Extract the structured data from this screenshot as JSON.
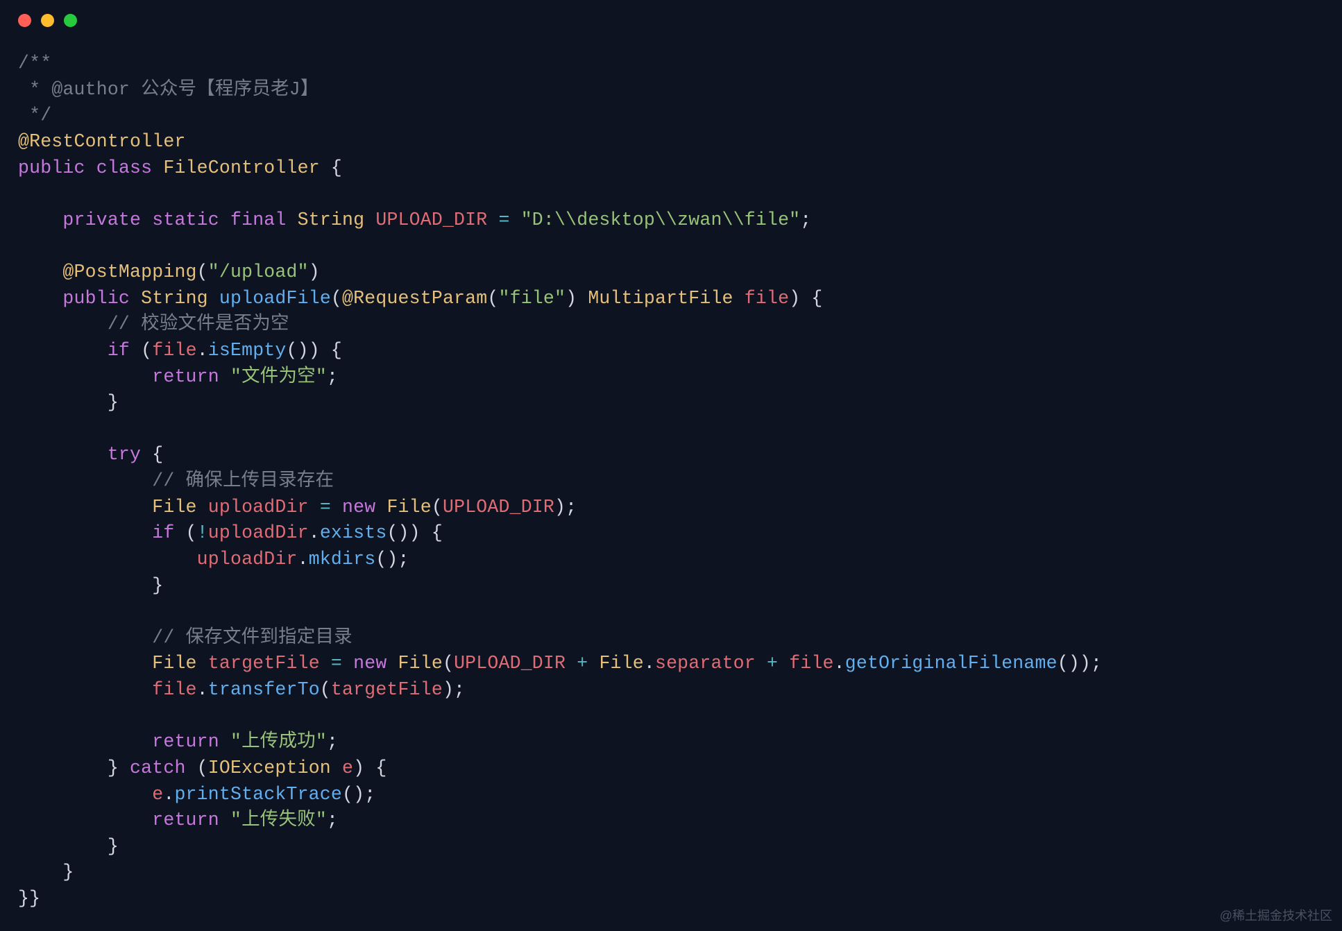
{
  "window": {
    "controls": [
      "close",
      "minimize",
      "maximize"
    ]
  },
  "code": {
    "lines": [
      {
        "tokens": [
          {
            "t": "/**",
            "c": "comment"
          }
        ]
      },
      {
        "tokens": [
          {
            "t": " * ",
            "c": "comment"
          },
          {
            "t": "@author",
            "c": "comment"
          },
          {
            "t": " 公众号【程序员老J】",
            "c": "comment"
          }
        ]
      },
      {
        "tokens": [
          {
            "t": " */",
            "c": "comment"
          }
        ]
      },
      {
        "tokens": [
          {
            "t": "@RestController",
            "c": "annotation"
          }
        ]
      },
      {
        "tokens": [
          {
            "t": "public",
            "c": "keyword"
          },
          {
            "t": " ",
            "c": "punc"
          },
          {
            "t": "class",
            "c": "keyword"
          },
          {
            "t": " ",
            "c": "punc"
          },
          {
            "t": "FileController",
            "c": "class"
          },
          {
            "t": " {",
            "c": "punc"
          }
        ]
      },
      {
        "tokens": [
          {
            "t": "",
            "c": "punc"
          }
        ]
      },
      {
        "tokens": [
          {
            "t": "    ",
            "c": "punc"
          },
          {
            "t": "private",
            "c": "keyword"
          },
          {
            "t": " ",
            "c": "punc"
          },
          {
            "t": "static",
            "c": "keyword"
          },
          {
            "t": " ",
            "c": "punc"
          },
          {
            "t": "final",
            "c": "keyword"
          },
          {
            "t": " ",
            "c": "punc"
          },
          {
            "t": "String",
            "c": "type"
          },
          {
            "t": " ",
            "c": "punc"
          },
          {
            "t": "UPLOAD_DIR",
            "c": "const"
          },
          {
            "t": " ",
            "c": "punc"
          },
          {
            "t": "=",
            "c": "op"
          },
          {
            "t": " ",
            "c": "punc"
          },
          {
            "t": "\"D:\\\\desktop\\\\zwan\\\\file\"",
            "c": "string"
          },
          {
            "t": ";",
            "c": "punc"
          }
        ]
      },
      {
        "tokens": [
          {
            "t": "",
            "c": "punc"
          }
        ]
      },
      {
        "tokens": [
          {
            "t": "    ",
            "c": "punc"
          },
          {
            "t": "@PostMapping",
            "c": "annotation"
          },
          {
            "t": "(",
            "c": "punc"
          },
          {
            "t": "\"/upload\"",
            "c": "string"
          },
          {
            "t": ")",
            "c": "punc"
          }
        ]
      },
      {
        "tokens": [
          {
            "t": "    ",
            "c": "punc"
          },
          {
            "t": "public",
            "c": "keyword"
          },
          {
            "t": " ",
            "c": "punc"
          },
          {
            "t": "String",
            "c": "type"
          },
          {
            "t": " ",
            "c": "punc"
          },
          {
            "t": "uploadFile",
            "c": "method"
          },
          {
            "t": "(",
            "c": "punc"
          },
          {
            "t": "@RequestParam",
            "c": "annotation"
          },
          {
            "t": "(",
            "c": "punc"
          },
          {
            "t": "\"file\"",
            "c": "string"
          },
          {
            "t": ") ",
            "c": "punc"
          },
          {
            "t": "MultipartFile",
            "c": "type"
          },
          {
            "t": " ",
            "c": "punc"
          },
          {
            "t": "file",
            "c": "param"
          },
          {
            "t": ") {",
            "c": "punc"
          }
        ]
      },
      {
        "tokens": [
          {
            "t": "        ",
            "c": "punc"
          },
          {
            "t": "// 校验文件是否为空",
            "c": "comment"
          }
        ]
      },
      {
        "tokens": [
          {
            "t": "        ",
            "c": "punc"
          },
          {
            "t": "if",
            "c": "keyword"
          },
          {
            "t": " (",
            "c": "punc"
          },
          {
            "t": "file",
            "c": "var"
          },
          {
            "t": ".",
            "c": "punc"
          },
          {
            "t": "isEmpty",
            "c": "method"
          },
          {
            "t": "()) {",
            "c": "punc"
          }
        ]
      },
      {
        "tokens": [
          {
            "t": "            ",
            "c": "punc"
          },
          {
            "t": "return",
            "c": "keyword"
          },
          {
            "t": " ",
            "c": "punc"
          },
          {
            "t": "\"文件为空\"",
            "c": "string"
          },
          {
            "t": ";",
            "c": "punc"
          }
        ]
      },
      {
        "tokens": [
          {
            "t": "        }",
            "c": "punc"
          }
        ]
      },
      {
        "tokens": [
          {
            "t": "",
            "c": "punc"
          }
        ]
      },
      {
        "tokens": [
          {
            "t": "        ",
            "c": "punc"
          },
          {
            "t": "try",
            "c": "keyword"
          },
          {
            "t": " {",
            "c": "punc"
          }
        ]
      },
      {
        "tokens": [
          {
            "t": "            ",
            "c": "punc"
          },
          {
            "t": "// 确保上传目录存在",
            "c": "comment"
          }
        ]
      },
      {
        "tokens": [
          {
            "t": "            ",
            "c": "punc"
          },
          {
            "t": "File",
            "c": "type"
          },
          {
            "t": " ",
            "c": "punc"
          },
          {
            "t": "uploadDir",
            "c": "var"
          },
          {
            "t": " ",
            "c": "punc"
          },
          {
            "t": "=",
            "c": "op"
          },
          {
            "t": " ",
            "c": "punc"
          },
          {
            "t": "new",
            "c": "keyword"
          },
          {
            "t": " ",
            "c": "punc"
          },
          {
            "t": "File",
            "c": "type"
          },
          {
            "t": "(",
            "c": "punc"
          },
          {
            "t": "UPLOAD_DIR",
            "c": "const"
          },
          {
            "t": ");",
            "c": "punc"
          }
        ]
      },
      {
        "tokens": [
          {
            "t": "            ",
            "c": "punc"
          },
          {
            "t": "if",
            "c": "keyword"
          },
          {
            "t": " (",
            "c": "punc"
          },
          {
            "t": "!",
            "c": "op"
          },
          {
            "t": "uploadDir",
            "c": "var"
          },
          {
            "t": ".",
            "c": "punc"
          },
          {
            "t": "exists",
            "c": "method"
          },
          {
            "t": "()) {",
            "c": "punc"
          }
        ]
      },
      {
        "tokens": [
          {
            "t": "                ",
            "c": "punc"
          },
          {
            "t": "uploadDir",
            "c": "var"
          },
          {
            "t": ".",
            "c": "punc"
          },
          {
            "t": "mkdirs",
            "c": "method"
          },
          {
            "t": "();",
            "c": "punc"
          }
        ]
      },
      {
        "tokens": [
          {
            "t": "            }",
            "c": "punc"
          }
        ]
      },
      {
        "tokens": [
          {
            "t": "",
            "c": "punc"
          }
        ]
      },
      {
        "tokens": [
          {
            "t": "            ",
            "c": "punc"
          },
          {
            "t": "// 保存文件到指定目录",
            "c": "comment"
          }
        ]
      },
      {
        "tokens": [
          {
            "t": "            ",
            "c": "punc"
          },
          {
            "t": "File",
            "c": "type"
          },
          {
            "t": " ",
            "c": "punc"
          },
          {
            "t": "targetFile",
            "c": "var"
          },
          {
            "t": " ",
            "c": "punc"
          },
          {
            "t": "=",
            "c": "op"
          },
          {
            "t": " ",
            "c": "punc"
          },
          {
            "t": "new",
            "c": "keyword"
          },
          {
            "t": " ",
            "c": "punc"
          },
          {
            "t": "File",
            "c": "type"
          },
          {
            "t": "(",
            "c": "punc"
          },
          {
            "t": "UPLOAD_DIR",
            "c": "const"
          },
          {
            "t": " ",
            "c": "punc"
          },
          {
            "t": "+",
            "c": "op"
          },
          {
            "t": " ",
            "c": "punc"
          },
          {
            "t": "File",
            "c": "type"
          },
          {
            "t": ".",
            "c": "punc"
          },
          {
            "t": "separator",
            "c": "var"
          },
          {
            "t": " ",
            "c": "punc"
          },
          {
            "t": "+",
            "c": "op"
          },
          {
            "t": " ",
            "c": "punc"
          },
          {
            "t": "file",
            "c": "var"
          },
          {
            "t": ".",
            "c": "punc"
          },
          {
            "t": "getOriginalFilename",
            "c": "method"
          },
          {
            "t": "());",
            "c": "punc"
          }
        ]
      },
      {
        "tokens": [
          {
            "t": "            ",
            "c": "punc"
          },
          {
            "t": "file",
            "c": "var"
          },
          {
            "t": ".",
            "c": "punc"
          },
          {
            "t": "transferTo",
            "c": "method"
          },
          {
            "t": "(",
            "c": "punc"
          },
          {
            "t": "targetFile",
            "c": "var"
          },
          {
            "t": ");",
            "c": "punc"
          }
        ]
      },
      {
        "tokens": [
          {
            "t": "",
            "c": "punc"
          }
        ]
      },
      {
        "tokens": [
          {
            "t": "            ",
            "c": "punc"
          },
          {
            "t": "return",
            "c": "keyword"
          },
          {
            "t": " ",
            "c": "punc"
          },
          {
            "t": "\"上传成功\"",
            "c": "string"
          },
          {
            "t": ";",
            "c": "punc"
          }
        ]
      },
      {
        "tokens": [
          {
            "t": "        } ",
            "c": "punc"
          },
          {
            "t": "catch",
            "c": "keyword"
          },
          {
            "t": " (",
            "c": "punc"
          },
          {
            "t": "IOException",
            "c": "type"
          },
          {
            "t": " ",
            "c": "punc"
          },
          {
            "t": "e",
            "c": "param"
          },
          {
            "t": ") {",
            "c": "punc"
          }
        ]
      },
      {
        "tokens": [
          {
            "t": "            ",
            "c": "punc"
          },
          {
            "t": "e",
            "c": "var"
          },
          {
            "t": ".",
            "c": "punc"
          },
          {
            "t": "printStackTrace",
            "c": "method"
          },
          {
            "t": "();",
            "c": "punc"
          }
        ]
      },
      {
        "tokens": [
          {
            "t": "            ",
            "c": "punc"
          },
          {
            "t": "return",
            "c": "keyword"
          },
          {
            "t": " ",
            "c": "punc"
          },
          {
            "t": "\"上传失败\"",
            "c": "string"
          },
          {
            "t": ";",
            "c": "punc"
          }
        ]
      },
      {
        "tokens": [
          {
            "t": "        }",
            "c": "punc"
          }
        ]
      },
      {
        "tokens": [
          {
            "t": "    }",
            "c": "punc"
          }
        ]
      },
      {
        "tokens": [
          {
            "t": "}}",
            "c": "punc"
          }
        ]
      }
    ]
  },
  "watermark": "@稀土掘金技术社区"
}
